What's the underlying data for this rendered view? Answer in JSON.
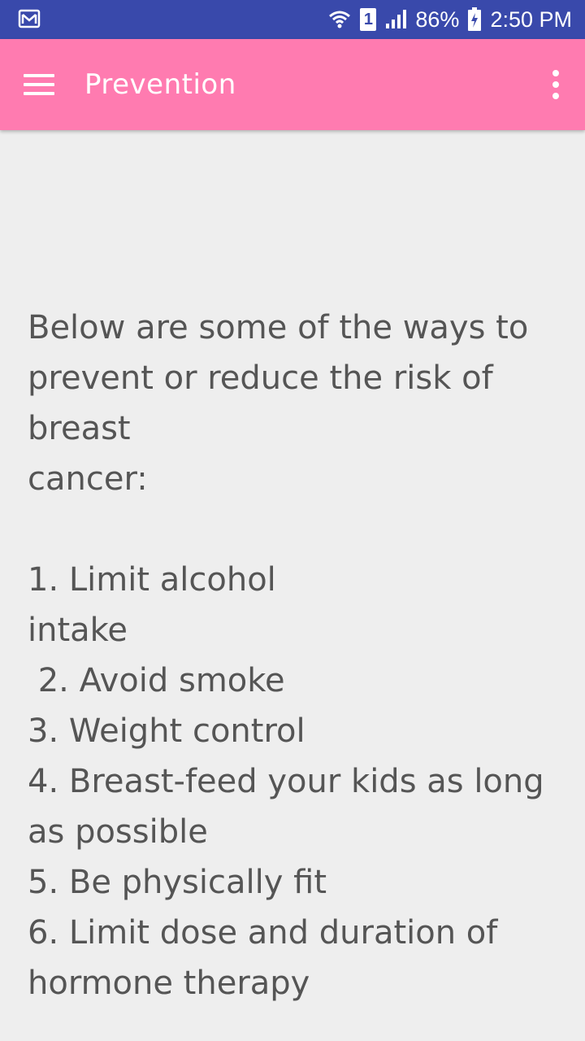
{
  "status_bar": {
    "left_icon": "gmail-notification-icon",
    "sim_label": "1",
    "battery_percent": "86%",
    "time": "2:50 PM",
    "icons": [
      "wifi-icon",
      "sim-icon",
      "signal-icon",
      "battery-charging-icon"
    ]
  },
  "app_bar": {
    "title": "Prevention",
    "menu_icon": "hamburger-menu-icon",
    "overflow_icon": "more-vert-icon",
    "background": "#ff7bb0"
  },
  "content": {
    "text": "Below are some of the ways to prevent or reduce the risk of breast\ncancer:\n\n1. Limit alcohol\nintake\n 2. Avoid smoke\n3. Weight control\n4. Breast-feed your kids as long as possible\n5. Be physically fit\n6. Limit dose and duration of hormone therapy"
  }
}
